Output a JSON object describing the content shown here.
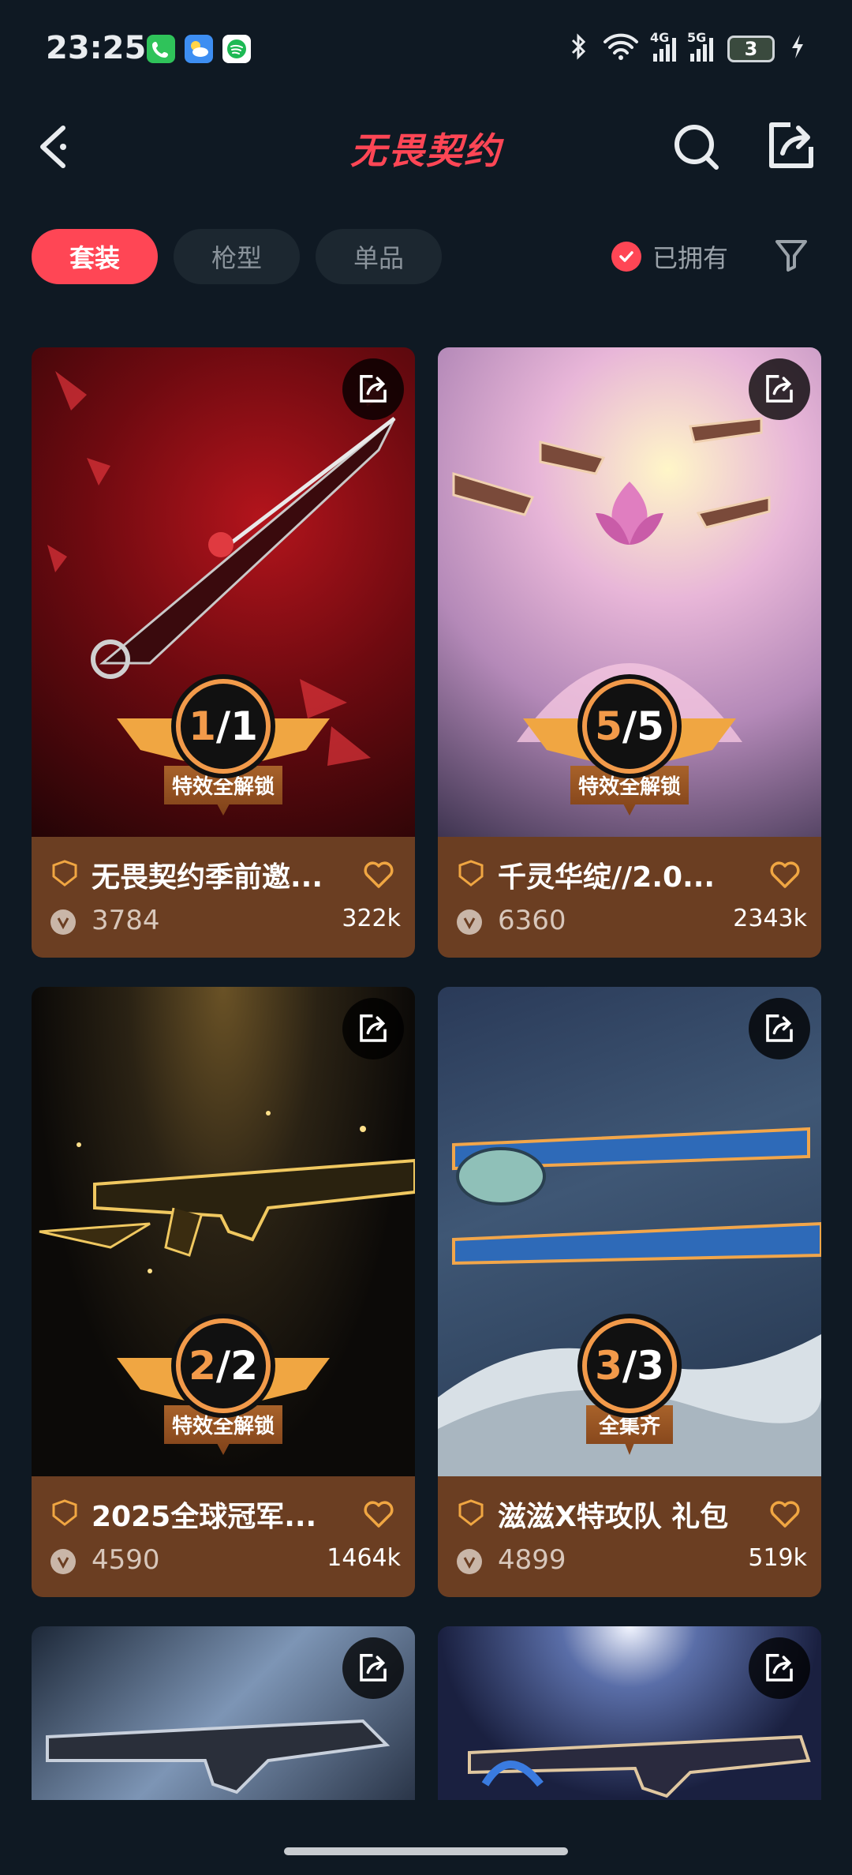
{
  "status": {
    "time": "23:25",
    "signal1": "4G",
    "signal2": "5G",
    "battery": "3"
  },
  "header": {
    "title": "无畏契约"
  },
  "tabs": [
    {
      "label": "套装",
      "active": true
    },
    {
      "label": "枪型",
      "active": false
    },
    {
      "label": "单品",
      "active": false
    }
  ],
  "filter": {
    "owned_label": "已拥有"
  },
  "cards": [
    {
      "title": "无畏契约季前邀...",
      "price": "3784",
      "views": "322k",
      "badge_a": "1",
      "badge_b": "1",
      "badge_label": "特效全解锁"
    },
    {
      "title": "千灵华绽//2.0...",
      "price": "6360",
      "views": "2343k",
      "badge_a": "5",
      "badge_b": "5",
      "badge_label": "特效全解锁"
    },
    {
      "title": "2025全球冠军...",
      "price": "4590",
      "views": "1464k",
      "badge_a": "2",
      "badge_b": "2",
      "badge_label": "特效全解锁"
    },
    {
      "title": "滋滋X特攻队 礼包",
      "price": "4899",
      "views": "519k",
      "badge_a": "3",
      "badge_b": "3",
      "badge_label": "全集齐"
    }
  ],
  "colors": {
    "accent": "#ff4655",
    "background": "#0f1923",
    "card_footer": "#6b3e22",
    "badge_orange": "#f29a4a"
  }
}
